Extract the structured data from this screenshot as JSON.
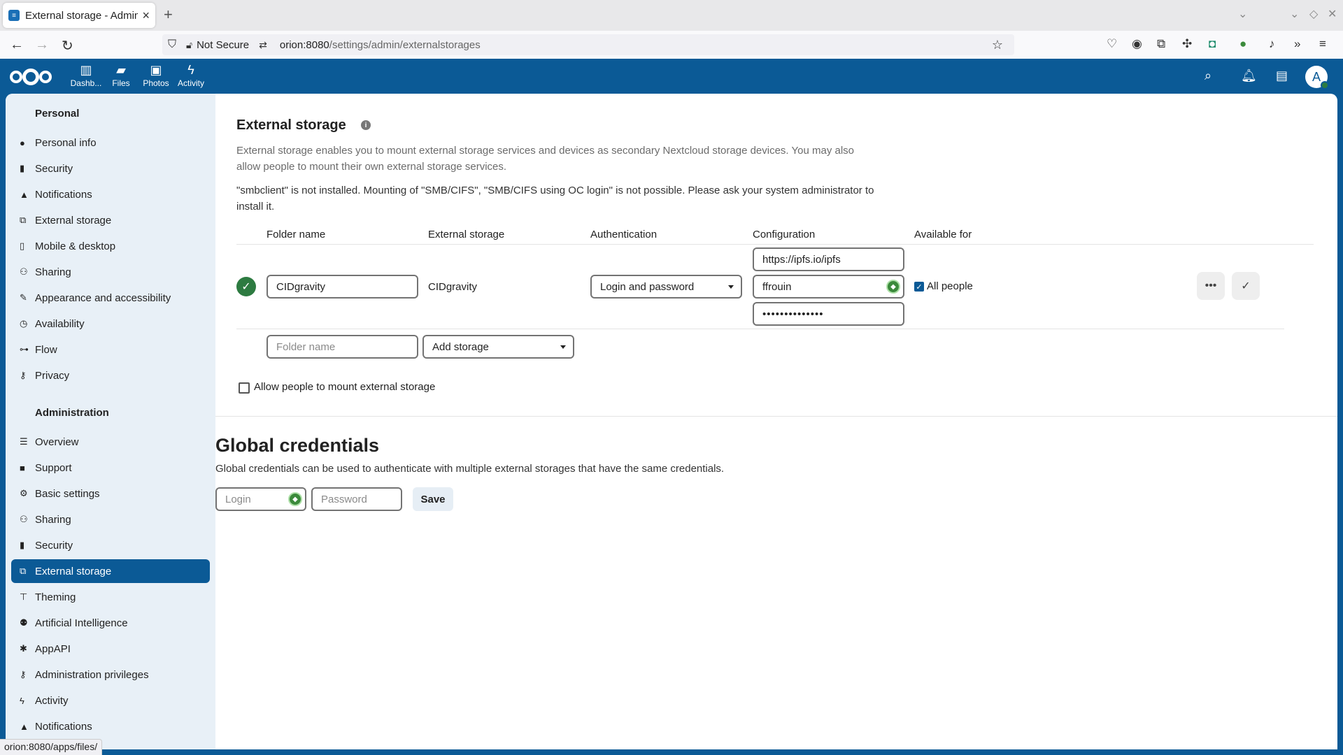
{
  "browser": {
    "tab_title": "External storage - Administ",
    "security_label": "Not Secure",
    "url_host": "orion:8080",
    "url_path": "/settings/admin/externalstorages",
    "status_url": "orion:8080/apps/files/"
  },
  "header": {
    "apps": [
      {
        "label": "Dashb..."
      },
      {
        "label": "Files"
      },
      {
        "label": "Photos"
      },
      {
        "label": "Activity"
      }
    ],
    "avatar_initial": "A"
  },
  "sidebar": {
    "personal_heading": "Personal",
    "personal_items": [
      {
        "label": "Personal info"
      },
      {
        "label": "Security"
      },
      {
        "label": "Notifications"
      },
      {
        "label": "External storage"
      },
      {
        "label": "Mobile & desktop"
      },
      {
        "label": "Sharing"
      },
      {
        "label": "Appearance and accessibility"
      },
      {
        "label": "Availability"
      },
      {
        "label": "Flow"
      },
      {
        "label": "Privacy"
      }
    ],
    "admin_heading": "Administration",
    "admin_items": [
      {
        "label": "Overview"
      },
      {
        "label": "Support"
      },
      {
        "label": "Basic settings"
      },
      {
        "label": "Sharing"
      },
      {
        "label": "Security"
      },
      {
        "label": "External storage"
      },
      {
        "label": "Theming"
      },
      {
        "label": "Artificial Intelligence"
      },
      {
        "label": "AppAPI"
      },
      {
        "label": "Administration privileges"
      },
      {
        "label": "Activity"
      },
      {
        "label": "Notifications"
      }
    ]
  },
  "main": {
    "title": "External storage",
    "description": "External storage enables you to mount external storage services and devices as secondary Nextcloud storage devices. You may also allow people to mount their own external storage services.",
    "warning": "\"smbclient\" is not installed. Mounting of \"SMB/CIFS\", \"SMB/CIFS using OC login\" is not possible. Please ask your system administrator to install it.",
    "columns": {
      "folder": "Folder name",
      "storage": "External storage",
      "auth": "Authentication",
      "config": "Configuration",
      "available": "Available for"
    },
    "mount": {
      "folder_name": "CIDgravity",
      "storage": "CIDgravity",
      "auth": "Login and password",
      "config_url": "https://ipfs.io/ipfs",
      "config_login": "ffrouin",
      "config_password": "••••••••••••••",
      "available_label": "All people"
    },
    "new_mount": {
      "folder_placeholder": "Folder name",
      "storage_select": "Add storage"
    },
    "allow_user_mount_label": "Allow people to mount external storage",
    "global": {
      "title": "Global credentials",
      "description": "Global credentials can be used to authenticate with multiple external storages that have the same credentials.",
      "login_placeholder": "Login",
      "password_placeholder": "Password",
      "save_label": "Save"
    }
  }
}
